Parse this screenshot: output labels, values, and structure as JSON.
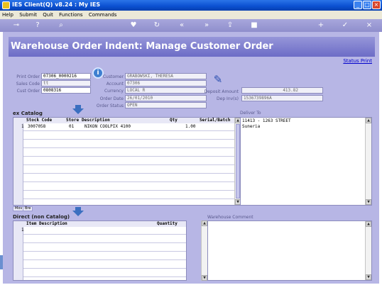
{
  "window": {
    "title": "IES Client(Q) v8.24 : My IES",
    "controls": [
      "minimize",
      "maximize",
      "close"
    ]
  },
  "menu": [
    "Help",
    "Submit",
    "Quit",
    "Functions",
    "Commands"
  ],
  "toolbar": {
    "icons": [
      "key-icon",
      "help-icon",
      "search-icon",
      "heart-icon",
      "refresh-icon",
      "rewind-icon",
      "forward-icon",
      "upload-icon",
      "stop-icon",
      "add-icon",
      "check-icon",
      "close-icon"
    ]
  },
  "page": {
    "title": "Warehouse Order Indent: Manage Customer Order",
    "status_link": "Status Print"
  },
  "form": {
    "print_order": {
      "label": "Print Order",
      "value": "07306_0000216"
    },
    "sales_code": {
      "label": "Sales Code",
      "value": "tt"
    },
    "cust_order": {
      "label": "Cust Order",
      "value": "0808316"
    },
    "customer": {
      "label": "Customer",
      "value": "GRABOWSKI, THERESA"
    },
    "account": {
      "label": "Account",
      "value": "07306"
    },
    "currency": {
      "label": "Currency",
      "value": "LOCAL R"
    },
    "order_date": {
      "label": "Order Date",
      "value": "26/01/2010"
    },
    "order_status": {
      "label": "Order Status",
      "value": "OPEN"
    },
    "deposit_amount": {
      "label": "Deposit Amount",
      "value": "413.82"
    },
    "dep_invoice": {
      "label": "Dep Inv(s)",
      "value": "1536739896A"
    }
  },
  "ex_catalog": {
    "title": "ex Catalog",
    "columns": [
      "Stock Code",
      "Store",
      "Description",
      "Qty",
      "Serial/Batch"
    ],
    "rows": [
      {
        "num": "1",
        "stock_code": "3007058",
        "store": "01",
        "description": "NIKON COOLPIX 4100",
        "qty": "1.00",
        "serial": ""
      }
    ],
    "tabs": [
      "Mov",
      "Bre"
    ]
  },
  "deliver_to": {
    "label": "Deliver To",
    "text": "11413 - 1263 STREET\nSuneria"
  },
  "direct": {
    "title": "Direct (non Catalog)",
    "columns": [
      "Item Description",
      "Quantity"
    ],
    "rows": [
      {
        "num": "1"
      }
    ]
  },
  "warehouse_comment": {
    "label": "Warehouse Comment",
    "text": ""
  },
  "colors": {
    "titlebar": "#0a4fd0",
    "background": "#b7b6e5",
    "banner": "#7878cc",
    "toolbar": "#9a99d4"
  }
}
